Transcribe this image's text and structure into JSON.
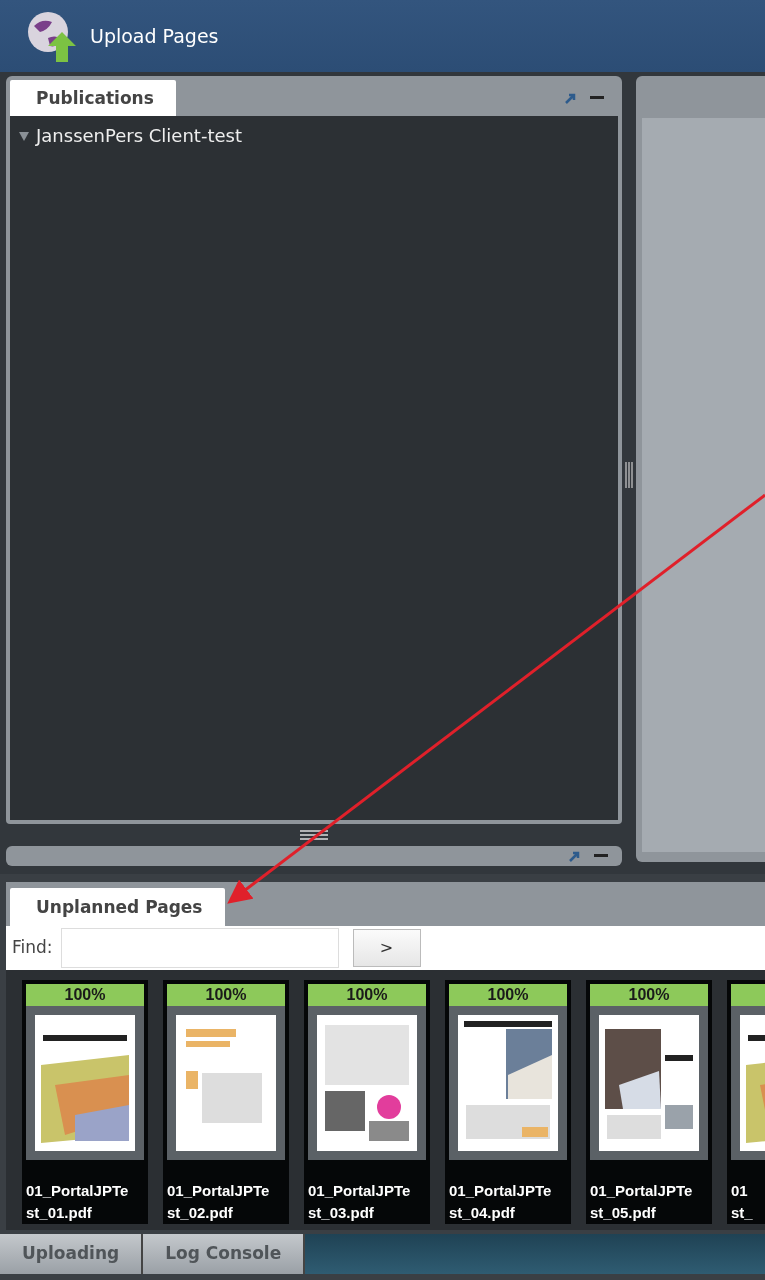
{
  "window": {
    "title": "Upload Pages"
  },
  "publications_panel": {
    "tab": {
      "label": "Publications",
      "selected": true
    },
    "tree": [
      {
        "label": "JanssenPers Client-test",
        "expanded": true
      }
    ]
  },
  "unplanned_pages": {
    "tab": {
      "label": "Unplanned Pages",
      "selected": true
    },
    "find": {
      "label": "Find:",
      "button": ">"
    },
    "pages": [
      {
        "progress": "100%",
        "level": 1,
        "name_lines": [
          "01_PortalJPTe",
          "st_01.pdf"
        ]
      },
      {
        "progress": "100%",
        "level": 1,
        "name_lines": [
          "01_PortalJPTe",
          "st_02.pdf"
        ]
      },
      {
        "progress": "100%",
        "level": 1,
        "name_lines": [
          "01_PortalJPTe",
          "st_03.pdf"
        ]
      },
      {
        "progress": "100%",
        "level": 1,
        "name_lines": [
          "01_PortalJPTe",
          "st_04.pdf"
        ]
      },
      {
        "progress": "100%",
        "level": 1,
        "name_lines": [
          "01_PortalJPTe",
          "st_05.pdf"
        ]
      },
      {
        "level": 1,
        "name_lines": [
          "01",
          "st_"
        ]
      }
    ]
  },
  "bottom_tabs": [
    {
      "label": "Uploading",
      "selected": false
    },
    {
      "label": "Log Console",
      "selected": false
    }
  ]
}
